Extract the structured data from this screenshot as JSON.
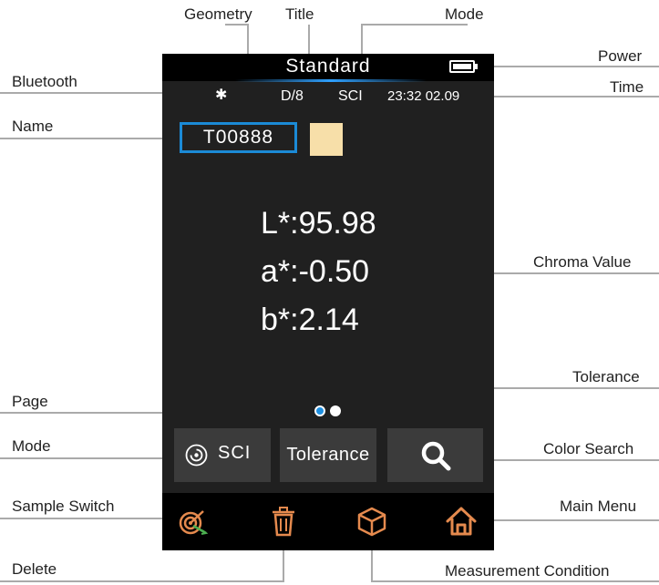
{
  "callouts": {
    "geometry": "Geometry",
    "title": "Title",
    "mode_top": "Mode",
    "power": "Power",
    "bluetooth": "Bluetooth",
    "time": "Time",
    "name": "Name",
    "chroma_value": "Chroma Value",
    "tolerance": "Tolerance",
    "page": "Page",
    "mode_button": "Mode",
    "color_search": "Color Search",
    "sample_switch": "Sample Switch",
    "main_menu": "Main Menu",
    "delete": "Delete",
    "measurement_condition": "Measurement Condition"
  },
  "screen": {
    "title": "Standard",
    "bluetooth_symbol": "✱",
    "geometry": "D/8",
    "mode": "SCI",
    "time": "23:32",
    "date": "02.09",
    "name": "T00888",
    "swatch_color": "#f7dfa9",
    "battery_level": 1.0,
    "chroma": {
      "L": "L*:95.98",
      "a": "a*:-0.50",
      "b": "b*:2.14"
    },
    "page": {
      "current": 1,
      "total": 2
    },
    "buttons": {
      "mode_label": "SCI",
      "tolerance_label": "Tolerance"
    }
  },
  "colors": {
    "accent_blue": "#1b8ad6",
    "icon_orange": "#e58a4e",
    "screen_bg": "#202020",
    "button_bg": "#3b3b3b"
  },
  "icons": [
    "bluetooth-icon",
    "battery-icon",
    "sci-mode-icon",
    "search-icon",
    "sample-switch-icon",
    "delete-icon",
    "measurement-condition-icon",
    "home-icon"
  ]
}
